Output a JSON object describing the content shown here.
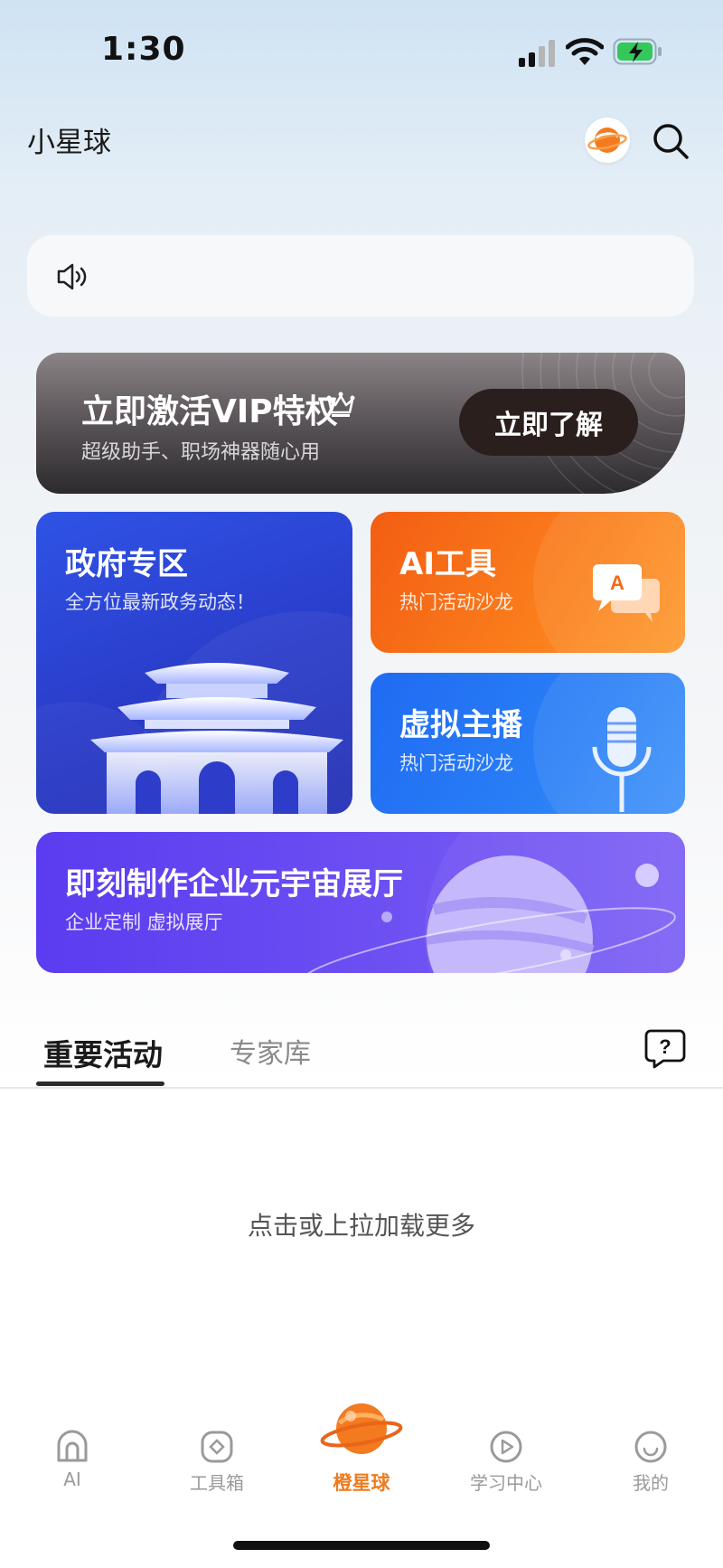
{
  "status_bar": {
    "time": "1:30"
  },
  "header": {
    "title": "小星球"
  },
  "vip_banner": {
    "title": "立即激活VIP特权",
    "subtitle": "超级助手、职场神器随心用",
    "button": "立即了解"
  },
  "cards": {
    "gov": {
      "title": "政府专区",
      "subtitle": "全方位最新政务动态！"
    },
    "ai_tool": {
      "title": "AI工具",
      "subtitle": "热门活动沙龙"
    },
    "vtuber": {
      "title": "虚拟主播",
      "subtitle": "热门活动沙龙"
    },
    "metaverse": {
      "title": "即刻制作企业元宇宙展厅",
      "subtitle": "企业定制 虚拟展厅"
    }
  },
  "tabs": [
    {
      "label": "重要活动",
      "active": true
    },
    {
      "label": "专家库",
      "active": false
    }
  ],
  "content": {
    "load_more": "点击或上拉加载更多"
  },
  "bottom_nav": [
    {
      "label": "AI",
      "icon": "ai-icon"
    },
    {
      "label": "工具箱",
      "icon": "toolbox-icon"
    },
    {
      "label": "橙星球",
      "icon": "orange-planet-icon",
      "active": true
    },
    {
      "label": "学习中心",
      "icon": "play-icon"
    },
    {
      "label": "我的",
      "icon": "smile-icon"
    }
  ],
  "colors": {
    "accent": "#f07a1c",
    "gov_card": "#2a3cc9",
    "ai_card": "#f35d13",
    "vtuber_card": "#1f6bf2",
    "meta_card": "#5b3cf0"
  }
}
